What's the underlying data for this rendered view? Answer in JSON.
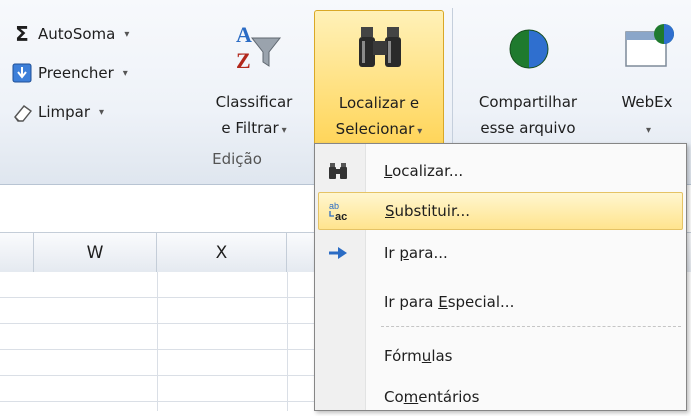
{
  "ribbon": {
    "autosum_label": "AutoSoma",
    "fill_label": "Preencher",
    "clear_label": "Limpar",
    "sort_filter_line1": "Classificar",
    "sort_filter_line2": "e Filtrar",
    "find_select_line1": "Localizar e",
    "find_select_line2": "Selecionar",
    "share_line1": "Compartilhar",
    "share_line2": "esse arquivo",
    "webex_label": "WebEx",
    "group_label": "Edição",
    "dropdown_arrow": "▾",
    "sigma": "Σ"
  },
  "columns": [
    "W",
    "X"
  ],
  "menu": {
    "items": [
      {
        "pre": "",
        "key": "L",
        "post": "ocalizar...",
        "icon": "binoculars-icon"
      },
      {
        "pre": "",
        "key": "S",
        "post": "ubstituir...",
        "icon": "replace-icon",
        "selected": true
      },
      {
        "pre": "Ir ",
        "key": "p",
        "post": "ara...",
        "icon": "goto-arrow-icon"
      },
      {
        "pre": "Ir para ",
        "key": "E",
        "post": "special...",
        "icon": ""
      },
      {
        "pre": "Fórm",
        "key": "u",
        "post": "las",
        "icon": ""
      },
      {
        "pre": "Co",
        "key": "m",
        "post": "entários",
        "icon": ""
      }
    ]
  },
  "colors": {
    "highlight": "#ffd559",
    "accent": "#2b6cc4"
  }
}
